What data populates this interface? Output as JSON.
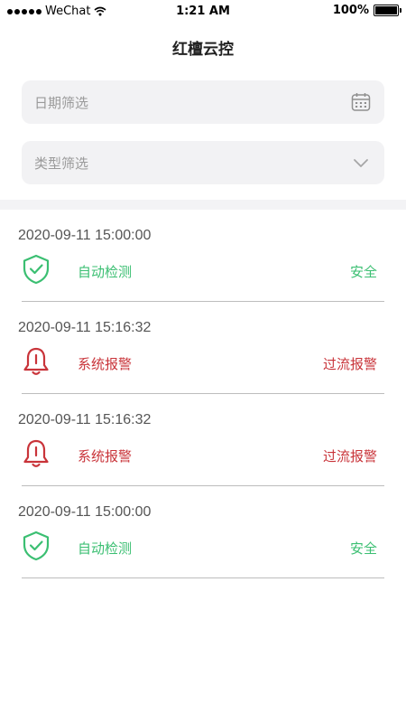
{
  "status_bar": {
    "carrier": "WeChat",
    "time": "1:21 AM",
    "battery": "100%",
    "battery_level": 100
  },
  "header": {
    "title": "红檀云控"
  },
  "filters": {
    "date_placeholder": "日期筛选",
    "type_placeholder": "类型筛选"
  },
  "colors": {
    "safe": "#3bbf72",
    "alarm": "#c9343a",
    "filter_bg": "#f2f2f4"
  },
  "records": [
    {
      "time": "2020-09-11  15:00:00",
      "icon": "shield-check-icon",
      "type": "自动检测",
      "status": "安全",
      "level": "safe"
    },
    {
      "time": "2020-09-11  15:16:32",
      "icon": "bell-alarm-icon",
      "type": "系统报警",
      "status": "过流报警",
      "level": "alarm"
    },
    {
      "time": "2020-09-11  15:16:32",
      "icon": "bell-alarm-icon",
      "type": "系统报警",
      "status": "过流报警",
      "level": "alarm"
    },
    {
      "time": "2020-09-11  15:00:00",
      "icon": "shield-check-icon",
      "type": "自动检测",
      "status": "安全",
      "level": "safe"
    }
  ]
}
